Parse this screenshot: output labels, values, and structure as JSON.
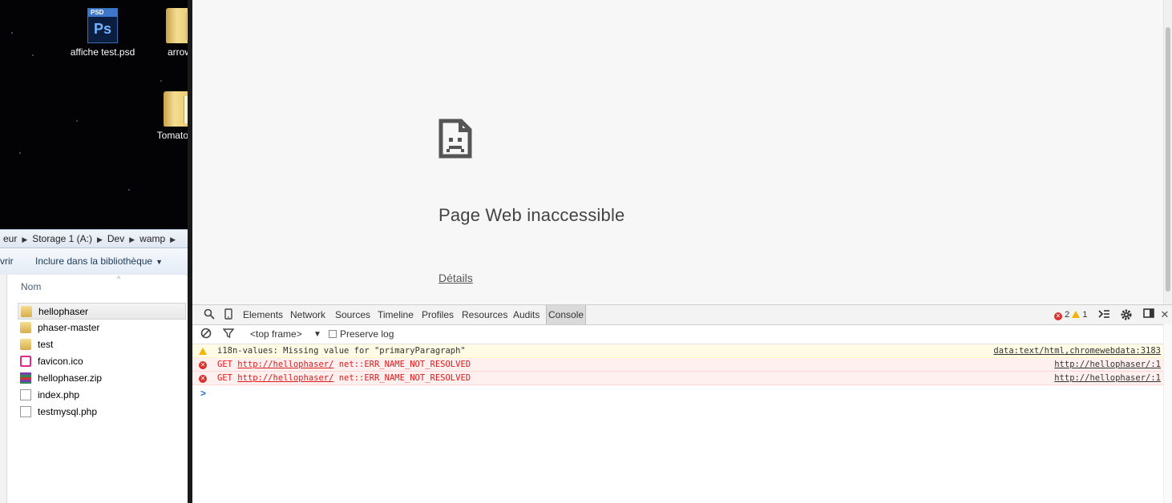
{
  "desktop": {
    "icons": [
      {
        "label": "affiche test.psd",
        "icon": "photoshop-file-icon",
        "tag": "PSD",
        "glyph": "Ps"
      },
      {
        "label": "arrow",
        "icon": "folder-icon"
      },
      {
        "label": "Tomato S",
        "icon": "folder-icon"
      }
    ]
  },
  "explorer": {
    "breadcrumbs": [
      "eur",
      "Storage 1 (A:)",
      "Dev",
      "wamp"
    ],
    "command_prev": "vrir",
    "include_label": "Inclure dans la bibliothèque",
    "column_header": "Nom",
    "files": [
      {
        "name": "hellophaser",
        "type": "folder",
        "selected": true
      },
      {
        "name": "phaser-master",
        "type": "folder"
      },
      {
        "name": "test",
        "type": "folder"
      },
      {
        "name": "favicon.ico",
        "type": "wamp"
      },
      {
        "name": "hellophaser.zip",
        "type": "zip"
      },
      {
        "name": "index.php",
        "type": "doc"
      },
      {
        "name": "testmysql.php",
        "type": "doc"
      }
    ]
  },
  "browser": {
    "error_title": "Page Web inaccessible",
    "details_link": "Détails",
    "icon": "sad-page-icon"
  },
  "devtools": {
    "tabs": [
      "Elements",
      "Network",
      "Sources",
      "Timeline",
      "Profiles",
      "Resources",
      "Audits",
      "Console"
    ],
    "active_tab": "Console",
    "error_count": "2",
    "warning_count": "1",
    "frame_select": "<top frame>",
    "preserve_log_label": "Preserve log",
    "preserve_log_checked": false,
    "messages": [
      {
        "level": "warning",
        "text": "i18n-values: Missing value for \"primaryParagraph\"",
        "source": "data:text/html,chromewebdata:3183"
      },
      {
        "level": "error",
        "method": "GET",
        "url": "http://hellophaser/",
        "error": "net::ERR_NAME_NOT_RESOLVED",
        "source": "http://hellophaser/:1"
      },
      {
        "level": "error",
        "method": "GET",
        "url": "http://hellophaser/",
        "error": "net::ERR_NAME_NOT_RESOLVED",
        "source": "http://hellophaser/:1"
      }
    ],
    "prompt": ">"
  }
}
